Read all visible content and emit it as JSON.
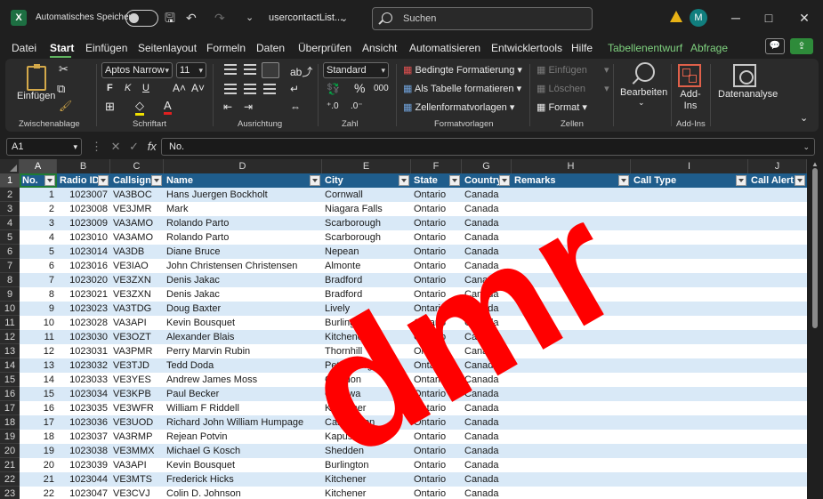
{
  "titlebar": {
    "app_icon_label": "X",
    "autosave_label": "Automatisches Speichern",
    "filename": "usercontactList...",
    "search_placeholder": "Suchen",
    "avatar_initial": "M",
    "minimize_glyph": "─",
    "maximize_glyph": "□",
    "close_glyph": "✕",
    "save_glyph": "🖫",
    "undo_glyph": "↶",
    "redo_glyph": "↷",
    "more_glyph": "⌄",
    "filename_caret": "⌄"
  },
  "menu": {
    "tabs": [
      "Datei",
      "Start",
      "Einfügen",
      "Seitenlayout",
      "Formeln",
      "Daten",
      "Überprüfen",
      "Ansicht",
      "Automatisieren",
      "Entwicklertools",
      "Hilfe",
      "Tabellenentwurf",
      "Abfrage"
    ],
    "active_tab": "Start",
    "comment_glyph": "💬",
    "share_glyph": "⇪"
  },
  "ribbon": {
    "paste_label": "Einfügen",
    "clipboard_group": "Zwischenablage",
    "font_name": "Aptos Narrow",
    "font_size": "11",
    "bold": "F",
    "italic": "K",
    "underline": "U",
    "grow_font": "A˄",
    "shrink_font": "A˅",
    "font_group": "Schriftart",
    "alignment_group": "Ausrichtung",
    "number_format": "Standard",
    "percent": "%",
    "thousands": "000",
    "number_group": "Zahl",
    "conditional_formatting": "Bedingte Formatierung",
    "format_as_table": "Als Tabelle formatieren",
    "cell_styles": "Zellenformatvorlagen",
    "styles_group": "Formatvorlagen",
    "insert_cells": "Einfügen",
    "delete_cells": "Löschen",
    "format_cells": "Format",
    "cells_group": "Zellen",
    "editing_label": "Bearbeiten",
    "addins_label": "Add-Ins",
    "addins_group": "Add-Ins",
    "data_analysis_label": "Datenanalyse",
    "collapse_glyph": "⌄"
  },
  "formula_bar": {
    "cell_ref": "A1",
    "fx": "fx",
    "content": "No."
  },
  "sheet": {
    "column_letters": [
      "A",
      "B",
      "C",
      "D",
      "E",
      "F",
      "G",
      "H",
      "I",
      "J"
    ],
    "row_numbers": [
      "1",
      "2",
      "3",
      "4",
      "5",
      "6",
      "7",
      "8",
      "9",
      "10",
      "11",
      "12",
      "13",
      "14",
      "15",
      "16",
      "17",
      "18",
      "19",
      "20",
      "21",
      "22",
      "23"
    ],
    "headers": [
      "No.",
      "Radio ID",
      "Callsign",
      "Name",
      "City",
      "State",
      "Country",
      "Remarks",
      "Call Type",
      "Call Alert"
    ],
    "rows": [
      [
        "1",
        "1023007",
        "VA3BOC",
        "Hans Juergen Bockholt",
        "Cornwall",
        "Ontario",
        "Canada",
        "",
        "",
        ""
      ],
      [
        "2",
        "1023008",
        "VE3JMR",
        "Mark",
        "Niagara Falls",
        "Ontario",
        "Canada",
        "",
        "",
        ""
      ],
      [
        "3",
        "1023009",
        "VA3AMO",
        "Rolando Parto",
        "Scarborough",
        "Ontario",
        "Canada",
        "",
        "",
        ""
      ],
      [
        "4",
        "1023010",
        "VA3AMO",
        "Rolando Parto",
        "Scarborough",
        "Ontario",
        "Canada",
        "",
        "",
        ""
      ],
      [
        "5",
        "1023014",
        "VA3DB",
        "Diane Bruce",
        "Nepean",
        "Ontario",
        "Canada",
        "",
        "",
        ""
      ],
      [
        "6",
        "1023016",
        "VE3IAO",
        "John Christensen Christensen",
        "Almonte",
        "Ontario",
        "Canada",
        "",
        "",
        ""
      ],
      [
        "7",
        "1023020",
        "VE3ZXN",
        "Denis Jakac",
        "Bradford",
        "Ontario",
        "Canada",
        "",
        "",
        ""
      ],
      [
        "8",
        "1023021",
        "VE3ZXN",
        "Denis Jakac",
        "Bradford",
        "Ontario",
        "Canada",
        "",
        "",
        ""
      ],
      [
        "9",
        "1023023",
        "VA3TDG",
        "Doug Baxter",
        "Lively",
        "Ontario",
        "Canada",
        "",
        "",
        ""
      ],
      [
        "10",
        "1023028",
        "VA3API",
        "Kevin Bousquet",
        "Burlington",
        "Ontario",
        "Canada",
        "",
        "",
        ""
      ],
      [
        "11",
        "1023030",
        "VE3OZT",
        "Alexander Blais",
        "Kitchener",
        "Ontario",
        "Canada",
        "",
        "",
        ""
      ],
      [
        "12",
        "1023031",
        "VA3PMR",
        "Perry Marvin Rubin",
        "Thornhill",
        "Ontario",
        "Canada",
        "",
        "",
        ""
      ],
      [
        "13",
        "1023032",
        "VE3TJD",
        "Tedd Doda",
        "Petersburg",
        "Ontario",
        "Canada",
        "",
        "",
        ""
      ],
      [
        "14",
        "1023033",
        "VE3YES",
        "Andrew James Moss",
        "Caledon",
        "Ontario",
        "Canada",
        "",
        "",
        ""
      ],
      [
        "15",
        "1023034",
        "VE3KPB",
        "Paul Becker",
        "Oshawa",
        "Ontario",
        "Canada",
        "",
        "",
        ""
      ],
      [
        "16",
        "1023035",
        "VE3WFR",
        "William F Riddell",
        "Kitchener",
        "Ontario",
        "Canada",
        "",
        "",
        ""
      ],
      [
        "17",
        "1023036",
        "VE3UOD",
        "Richard John William Humpage",
        "Cannington",
        "Ontario",
        "Canada",
        "",
        "",
        ""
      ],
      [
        "18",
        "1023037",
        "VA3RMP",
        "Rejean Potvin",
        "Kapuskasing",
        "Ontario",
        "Canada",
        "",
        "",
        ""
      ],
      [
        "19",
        "1023038",
        "VE3MMX",
        "Michael G Kosch",
        "Shedden",
        "Ontario",
        "Canada",
        "",
        "",
        ""
      ],
      [
        "20",
        "1023039",
        "VA3API",
        "Kevin Bousquet",
        "Burlington",
        "Ontario",
        "Canada",
        "",
        "",
        ""
      ],
      [
        "21",
        "1023044",
        "VE3MTS",
        "Frederick Hicks",
        "Kitchener",
        "Ontario",
        "Canada",
        "",
        "",
        ""
      ],
      [
        "22",
        "1023047",
        "VE3CVJ",
        "Colin D. Johnson",
        "Kitchener",
        "Ontario",
        "Canada",
        "",
        "",
        ""
      ]
    ]
  },
  "watermark": "dmr",
  "colors": {
    "accent": "#5fb35f",
    "table_header": "#1f5d8c",
    "band": "#d9e9f7",
    "watermark": "#ff0000"
  },
  "icons": [
    "excel-app-icon",
    "save-icon",
    "undo-icon",
    "redo-icon",
    "search-icon",
    "warning-icon",
    "comment-icon",
    "share-icon",
    "paste-icon",
    "cut-icon",
    "copy-icon",
    "format-painter-icon",
    "borders-icon",
    "fill-color-icon",
    "font-color-icon",
    "percent-icon",
    "find-icon",
    "addins-icon",
    "data-analysis-icon"
  ]
}
